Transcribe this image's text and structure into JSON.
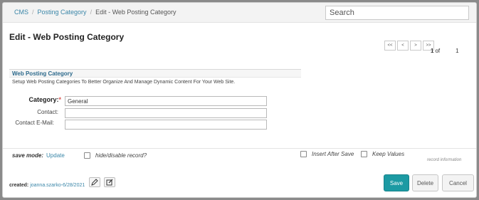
{
  "breadcrumb": {
    "items": [
      "CMS",
      "Posting Category",
      "Edit - Web Posting Category"
    ],
    "separator": "/"
  },
  "search": {
    "placeholder": "Search",
    "value": ""
  },
  "page": {
    "title": "Edit - Web Posting Category"
  },
  "pager": {
    "first": "<<",
    "prev": "<",
    "next": ">",
    "last": ">>",
    "current": "1",
    "of_label": "of",
    "total": "1"
  },
  "section": {
    "title": "Web Posting Category",
    "description": "Setup Web Posting Categories To Better Organize And Manage Dynamic Content For Your Web Site."
  },
  "form": {
    "category": {
      "label": "Category:",
      "required_mark": "*",
      "value": "General"
    },
    "contact": {
      "label": "Contact:",
      "value": ""
    },
    "contact_email": {
      "label": "Contact E-Mail:",
      "value": ""
    }
  },
  "options": {
    "save_mode_label": "save mode:",
    "save_mode_value": "Update",
    "hide_record_label": "hide/disable record?",
    "insert_after_save_label": "Insert After Save",
    "keep_values_label": "Keep Values",
    "record_information": "record information"
  },
  "meta": {
    "created_label": "created:",
    "created_value": "joanna.szarko-6/28/2021"
  },
  "buttons": {
    "save": "Save",
    "delete": "Delete",
    "cancel": "Cancel"
  },
  "colors": {
    "accent": "#1c9aa3",
    "link": "#3a86a8",
    "section_title": "#2d6a8c",
    "required": "#d9534f"
  }
}
